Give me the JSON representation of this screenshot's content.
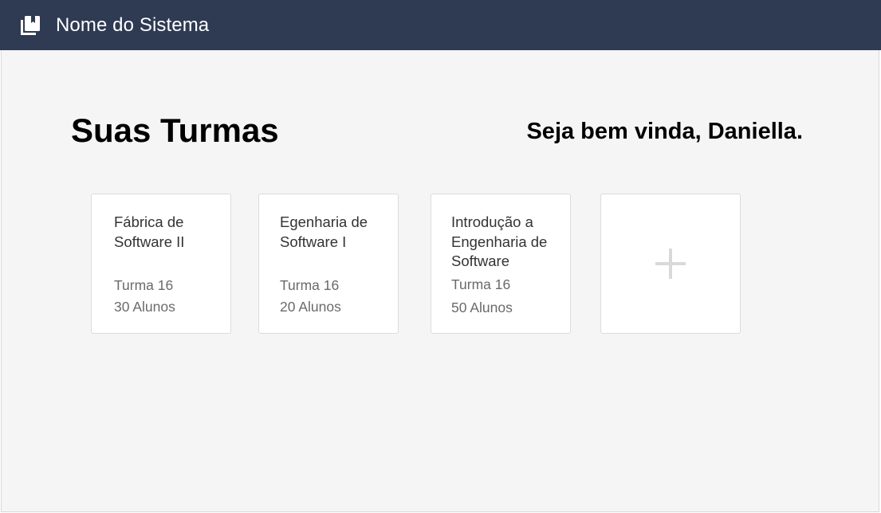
{
  "header": {
    "brand_icon": "book-library-icon",
    "title": "Nome do Sistema",
    "background": "#2f3a53"
  },
  "main": {
    "title": "Suas Turmas",
    "welcome": "Seja bem vinda, Daniella."
  },
  "courses": [
    {
      "name": "Fábrica de Software II",
      "class": "Turma 16",
      "students": "30 Alunos"
    },
    {
      "name": "Egenharia de Software I",
      "class": "Turma 16",
      "students": "20 Alunos"
    },
    {
      "name": "Introdução a Engenharia de Software",
      "class": "Turma 16",
      "students": "50 Alunos"
    }
  ],
  "add_course": {
    "icon": "plus-icon",
    "color": "#d9d9d9"
  }
}
